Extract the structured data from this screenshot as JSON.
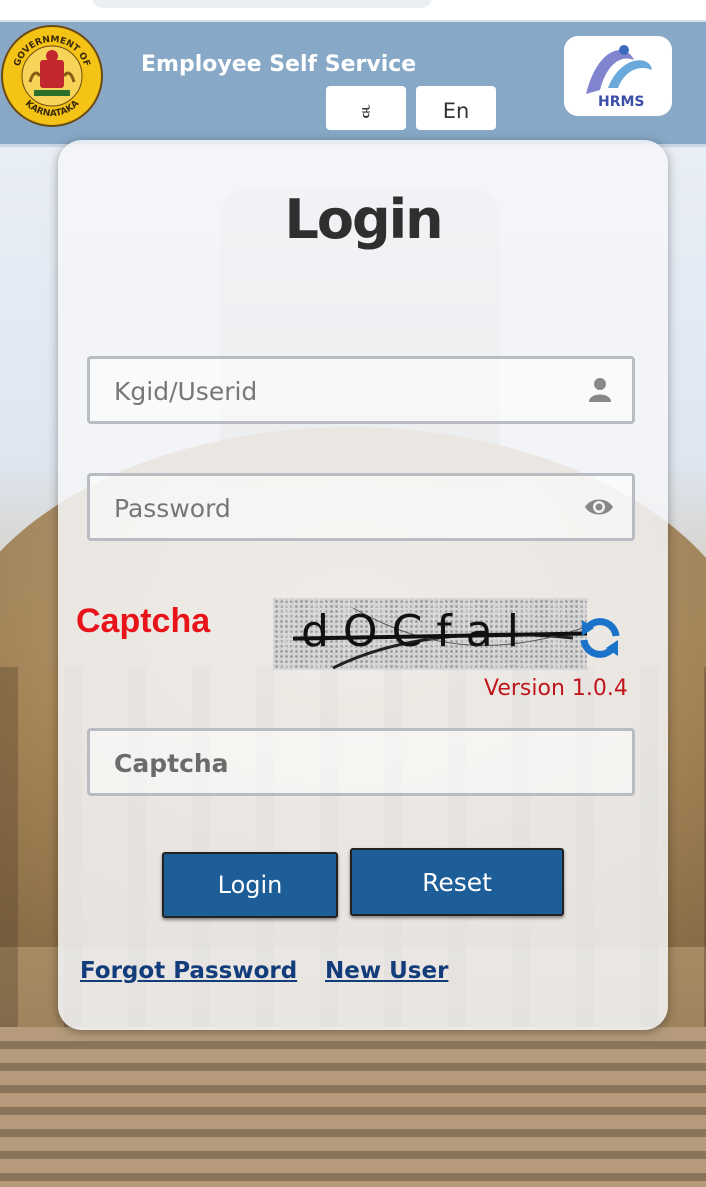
{
  "header": {
    "app_title": "Employee Self Service",
    "lang_kannada": "ಕ",
    "lang_english": "En",
    "emblem_top_text": "GOVERNMENT OF",
    "emblem_bottom_text": "KARNATAKA",
    "hrms_logo_text": "HRMS",
    "background_color": "#87a8c6"
  },
  "login": {
    "title": "Login",
    "userid_placeholder": "Kgid/Userid",
    "password_placeholder": "Password",
    "captcha_label": "Captcha",
    "captcha_image_text": "dOCfal",
    "version": "Version 1.0.4",
    "captcha_input_placeholder": "Captcha",
    "login_button": "Login",
    "reset_button": "Reset",
    "forgot_password_link": "Forgot Password",
    "new_user_link": "New User"
  },
  "icons": {
    "user_field": "user-icon",
    "password_field": "eye-icon",
    "captcha_refresh": "refresh-icon"
  },
  "colors": {
    "button": "#1d5d98",
    "captcha_label": "#e8141a",
    "version": "#c0161b",
    "link": "#123c7a"
  }
}
